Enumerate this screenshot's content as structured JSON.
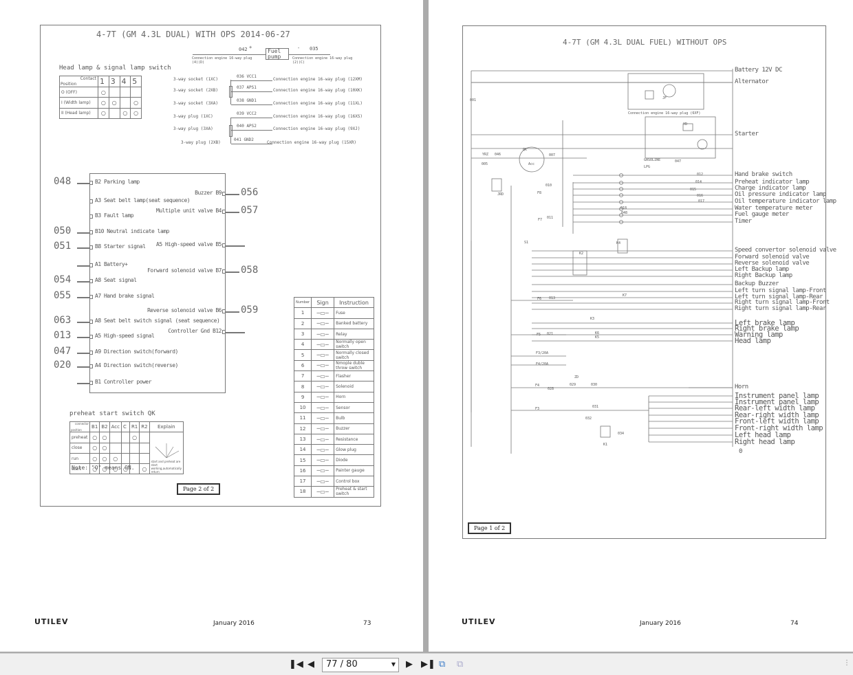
{
  "left_page": {
    "title": "4-7T (GM 4.3L DUAL) WITH OPS  2014-06-27",
    "fuel_pump": {
      "label": "Fuel pump",
      "wire_in": "042",
      "wire_out": "035",
      "plus": "+",
      "minus": "-",
      "conn_in": "Connection engine 16-way plug (4)(D)",
      "conn_out": "Connection engine 16-way plug (2)(C)"
    },
    "sensors": [
      {
        "left": "3-way socket (1XC)",
        "wire": "036 VCC1",
        "right": "Connection engine 16-way plug (12XM)"
      },
      {
        "left": "3-way socket (2XB)",
        "wire": "037 APS1",
        "right": "Connection engine 16-way plug (10XK)"
      },
      {
        "left": "3-way socket (3XA)",
        "wire": "038 GND1",
        "right": "Connection engine 16-way plug (11XL)"
      },
      {
        "left": "3-way plug (1XC)",
        "wire": "039 VCC2",
        "right": "Connection engine 16-way plug (16XS)"
      },
      {
        "left": "3-way plug (3XA)",
        "wire": "040 APS2",
        "right": "Connection engine 16-way plug (9XJ)"
      },
      {
        "left": "3-way plug (2XB)",
        "wire": "041 GND2",
        "right": "Connection engine 16-way plug (15XR)"
      }
    ],
    "headlamp_switch": {
      "title": "Head lamp & signal lamp switch",
      "corner_top": "Contact",
      "corner_bottom": "Position",
      "columns": [
        "1",
        "3",
        "4",
        "5"
      ],
      "rows": [
        {
          "pos": "O   (OFF)",
          "on": [
            1,
            0,
            0,
            0
          ]
        },
        {
          "pos": "I  (Width lamp)",
          "on": [
            1,
            1,
            0,
            1
          ]
        },
        {
          "pos": "II  (Head lamp)",
          "on": [
            1,
            0,
            1,
            1
          ]
        }
      ]
    },
    "controller_left": [
      {
        "wire": "048",
        "label": "B2 Parking lamp"
      },
      {
        "wire": "",
        "label": "A3 Seat belt lamp(seat sequence)"
      },
      {
        "wire": "",
        "label": "B3 Fault lamp"
      },
      {
        "wire": "050",
        "label": "B10 Neutral indicate lamp"
      },
      {
        "wire": "051",
        "label": "B8 Starter signal"
      },
      {
        "wire": "",
        "label": "A1 Battery+"
      },
      {
        "wire": "054",
        "label": "A8 Seat signal"
      },
      {
        "wire": "055",
        "label": "A7  Hand brake signal"
      },
      {
        "wire": "063",
        "label": "A8 Seat belt switch signal (seat sequence)"
      },
      {
        "wire": "013",
        "label": "A5 High-speed signal"
      },
      {
        "wire": "047",
        "label": "A9 Direction switch(forward)"
      },
      {
        "wire": "020",
        "label": "A4 Direction switch(reverse)"
      },
      {
        "wire": "",
        "label": "B1  Controller power"
      }
    ],
    "controller_right": [
      {
        "wire": "056",
        "label": "Buzzer B9"
      },
      {
        "wire": "057",
        "label": "Multiple unit valve B4"
      },
      {
        "wire": "",
        "label": "A5 High-speed valve B5"
      },
      {
        "wire": "058",
        "label": "Forward solenoid valve B7"
      },
      {
        "wire": "059",
        "label": "Reverse solenoid valve B6"
      },
      {
        "wire": "",
        "label": "Controller Gnd B12"
      }
    ],
    "legend": {
      "headers": [
        "Number",
        "Sign",
        "Instruction"
      ],
      "rows": [
        [
          "1",
          "Fuse"
        ],
        [
          "2",
          "Banked battery"
        ],
        [
          "3",
          "Relay"
        ],
        [
          "4",
          "Normally open switch"
        ],
        [
          "5",
          "Normally closed switch"
        ],
        [
          "6",
          "Nmople duble throw switch"
        ],
        [
          "7",
          "Flasher"
        ],
        [
          "8",
          "Solenoid"
        ],
        [
          "9",
          "Horn"
        ],
        [
          "10",
          "Sensor"
        ],
        [
          "11",
          "Bulb"
        ],
        [
          "12",
          "Buzzer"
        ],
        [
          "13",
          "Resistance"
        ],
        [
          "14",
          "Glow plug"
        ],
        [
          "15",
          "Diode"
        ],
        [
          "16",
          "Painter  gauge"
        ],
        [
          "17",
          "Control box"
        ],
        [
          "18",
          "Preheat & start switch"
        ]
      ]
    },
    "preheat_switch": {
      "title": "preheat start switch QK",
      "corner_top": "connector",
      "corner_bottom": "position",
      "columns": [
        "B1",
        "B2",
        "Acc",
        "C",
        "R1",
        "R2"
      ],
      "explain_header": "Explain",
      "explain_text": "start and preheat are start working,automatically return",
      "rows": [
        {
          "pos": "preheat",
          "on": [
            1,
            1,
            0,
            0,
            1,
            0
          ]
        },
        {
          "pos": "close",
          "on": [
            1,
            1,
            0,
            0,
            0,
            0
          ]
        },
        {
          "pos": "run",
          "on": [
            1,
            1,
            1,
            0,
            0,
            0
          ]
        },
        {
          "pos": "start",
          "on": [
            1,
            1,
            1,
            1,
            0,
            1
          ]
        }
      ]
    },
    "note": "Note: \"O\" means ON.",
    "page_box": "Page 2 of 2",
    "footer": {
      "logo": "UTILEV",
      "date": "January 2016",
      "page": "73"
    }
  },
  "right_page": {
    "title": "4-7T (GM 4.3L DUAL FUEL) WITHOUT OPS",
    "loads": [
      "Battery 12V DC",
      "Alternator",
      "Starter",
      "Hand brake switch",
      "Preheat indicator lamp",
      "Charge indicator lamp",
      "Oil pressure indicator lamp",
      "Oil temperature indicator lamp",
      "Water temperature meter",
      "Fuel gauge meter",
      "Timer",
      "Speed convertor solenoid valve",
      "Forward solenoid valve",
      "Reverse solenoid valve",
      "Left Backup lamp",
      "Right Backup lamp",
      "Backup Buzzer",
      "Left turn signal lamp-Front",
      "Left turn signal lamp-Rear",
      "Right turn signal lamp-Front",
      "Right turn signal lamp-Rear",
      "Left brake lamp",
      "Right brake lamp",
      "Warning lamp",
      "Head lamp",
      "Horn",
      "Instrument panel lamp",
      "Instrument panel lamp",
      "Rear-left width lamp",
      "Rear-right width lamp",
      "Front-left width lamp",
      "Front-right width lamp",
      "Left head lamp",
      "Right head lamp"
    ],
    "ground": "0",
    "wires": [
      "001",
      "YRZ",
      "046",
      "005",
      "007",
      "010",
      "F8",
      "F7",
      "011",
      "JRD",
      "QK",
      "Acc",
      "GASOLINE",
      "LPG",
      "047",
      "012",
      "014",
      "015",
      "016",
      "017",
      "018",
      "048",
      "Connection engine 16-way plug (6XF)",
      "F6",
      "013",
      "F5",
      "021",
      "F3/20A",
      "F4/20A",
      "F4",
      "F3",
      "028",
      "029",
      "030",
      "031",
      "032",
      "034",
      "K1",
      "K2",
      "K3",
      "K4",
      "K5",
      "K6",
      "K7",
      "S1",
      "ZD",
      "JF",
      "YD"
    ],
    "page_box": "Page 1 of 2",
    "footer": {
      "logo": "UTILEV",
      "date": "January 2016",
      "page": "74"
    }
  },
  "toolbar": {
    "first": "first-page",
    "prev": "previous-page",
    "page_indicator": "77 / 80",
    "next": "next-page",
    "last": "last-page"
  }
}
